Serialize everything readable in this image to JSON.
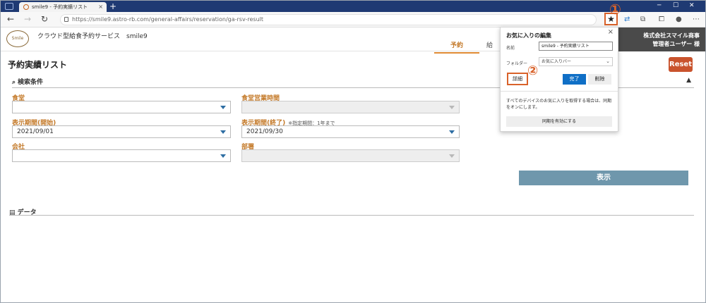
{
  "browser": {
    "tab_title": "smile9 - 予約実績リスト",
    "tab_close": "×",
    "new_tab": "+",
    "url": "https://smile9.astro-rb.com/general-affairs/reservation/ga-rsv-result",
    "annotation_1": "①",
    "annotation_2": "②"
  },
  "app": {
    "brand": "クラウド型給食予約サービス　smile9",
    "logo_text": "Smile",
    "nav_active": "予約",
    "nav_next": "給",
    "company": "株式会社スマイル商事",
    "user": "管理者ユーザー 様"
  },
  "page": {
    "title": "予約実績リスト",
    "reset": "Reset",
    "search_section": "検索条件",
    "display_button": "表示",
    "data_section": "データ"
  },
  "fields": {
    "cafeteria_label": "食堂",
    "cafeteria_value": "",
    "hours_label": "食堂営業時間",
    "hours_value": "",
    "start_label": "表示期間(開始)",
    "start_value": "2021/09/01",
    "end_label": "表示期間(終了)",
    "end_note": "※指定期間：1年まで",
    "end_value": "2021/09/30",
    "company_label": "会社",
    "company_value": "",
    "dept_label": "部署",
    "dept_value": ""
  },
  "favorites_popup": {
    "title": "お気に入りの編集",
    "name_label": "名前",
    "name_value": "smile9 - 予約実績リスト",
    "folder_label": "フォルダー",
    "folder_value": "お気に入りバー",
    "detail": "詳細",
    "done": "完了",
    "delete": "削除",
    "sync_text": "すべてのデバイスのお気に入りを取得する場合は、同期をオンにします。",
    "sync_button": "同期を有効にする",
    "close": "×"
  },
  "colors": {
    "accent_orange": "#c47a2a",
    "annotation": "#d9622a",
    "reset": "#c9532d",
    "display_button": "#6f97ac",
    "done_button": "#0f6fc6"
  }
}
